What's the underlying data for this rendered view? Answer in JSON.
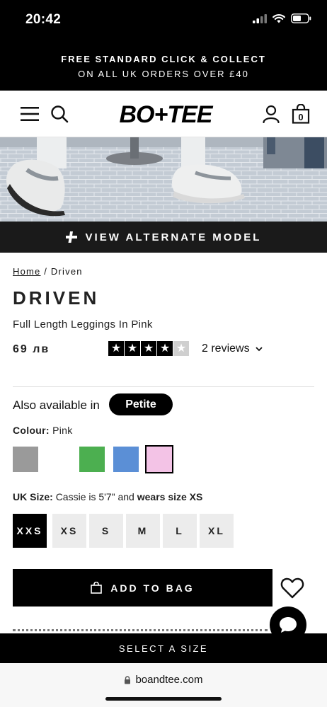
{
  "status_bar": {
    "time": "20:42"
  },
  "promo": {
    "line1": "FREE STANDARD CLICK & COLLECT",
    "line2": "ON ALL UK ORDERS OVER £40"
  },
  "header": {
    "logo_text": "BO+TEE",
    "bag_count": "0",
    "icons": [
      "menu-icon",
      "search-icon",
      "account-icon",
      "bag-icon"
    ]
  },
  "alt_model": {
    "label": "VIEW ALTERNATE MODEL",
    "icon": "plus-bolt-icon"
  },
  "breadcrumb": {
    "home": "Home",
    "separator": "/",
    "current": "Driven"
  },
  "product": {
    "brand": "DRIVEN",
    "name": "Full Length Leggings In Pink",
    "price": "69 лв",
    "rating": 4,
    "rating_max": 5,
    "reviews_label": "2 reviews"
  },
  "also_available": {
    "text": "Also available in",
    "option": "Petite"
  },
  "colour": {
    "label": "Colour:",
    "selected": "Pink",
    "swatches": [
      {
        "name": "grey",
        "color": "#9a9a9a"
      },
      {
        "name": "white",
        "color": "#ffffff"
      },
      {
        "name": "green",
        "color": "#4caf50"
      },
      {
        "name": "blue",
        "color": "#5b8fd6"
      },
      {
        "name": "pink",
        "color": "#f3c3e6"
      }
    ]
  },
  "size": {
    "label": "UK Size:",
    "note_prefix": "Cassie is 5'7\" and",
    "note_bold": "wears size XS",
    "options": [
      "XXS",
      "XS",
      "S",
      "M",
      "L",
      "XL"
    ],
    "selected": "XXS"
  },
  "add_to_bag": {
    "label": "ADD TO BAG"
  },
  "select_size_bar": {
    "label": "SELECT A SIZE"
  },
  "browser": {
    "url": "boandtee.com"
  }
}
